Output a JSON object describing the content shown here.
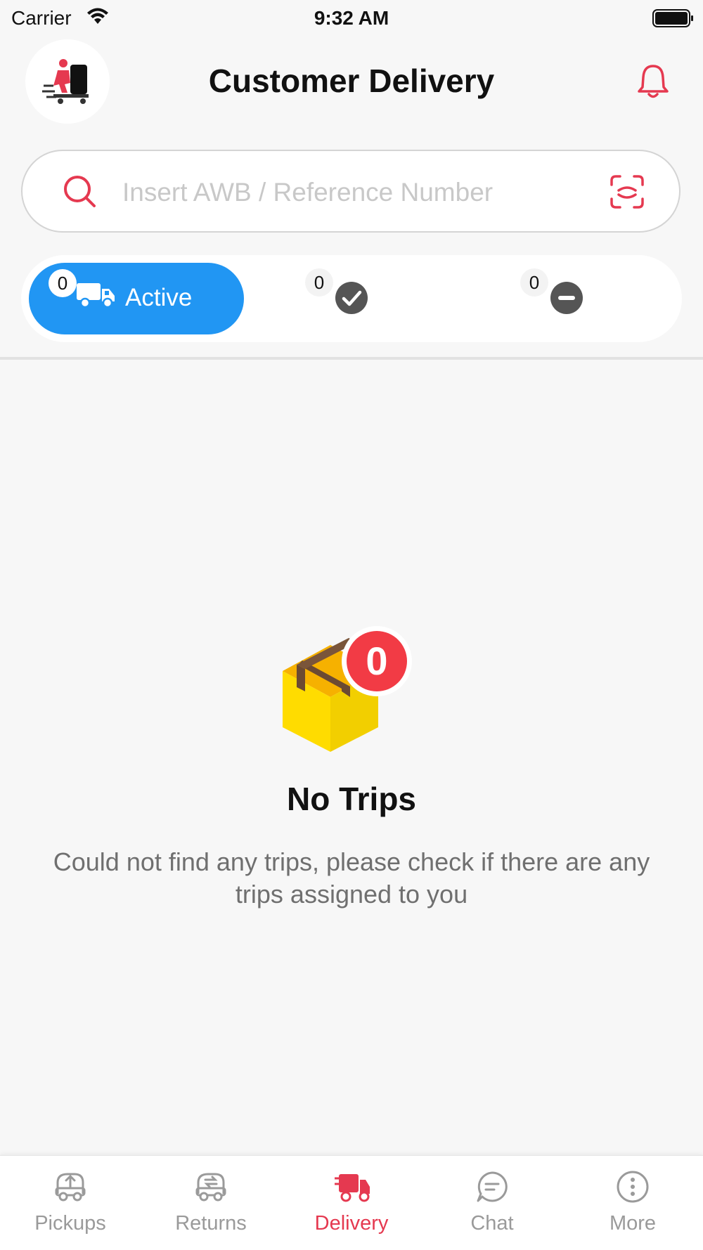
{
  "status_bar": {
    "carrier": "Carrier",
    "time": "9:32 AM",
    "icons": [
      "wifi-icon",
      "battery-icon"
    ]
  },
  "header": {
    "title": "Customer Delivery",
    "logo": "delivery-courier-logo",
    "right_icon": "bell-icon"
  },
  "search": {
    "placeholder": "Insert AWB / Reference Number",
    "value": "",
    "left_icon": "search-icon",
    "right_icon": "scan-icon"
  },
  "filter_tabs": [
    {
      "label": "Active",
      "count": "0",
      "icon": "truck-icon",
      "selected": true
    },
    {
      "label": "",
      "count": "0",
      "icon": "check-circle-icon",
      "selected": false
    },
    {
      "label": "",
      "count": "0",
      "icon": "minus-circle-icon",
      "selected": false
    }
  ],
  "empty_state": {
    "icon": "box-icon",
    "badge_count": "0",
    "title": "No Trips",
    "message": "Could not find any trips, please check if there are any trips assigned to you"
  },
  "tab_bar": {
    "items": [
      {
        "label": "Pickups",
        "icon": "pickup-truck-icon",
        "active": false
      },
      {
        "label": "Returns",
        "icon": "returns-truck-icon",
        "active": false
      },
      {
        "label": "Delivery",
        "icon": "delivery-truck-icon",
        "active": true
      },
      {
        "label": "Chat",
        "icon": "chat-icon",
        "active": false
      },
      {
        "label": "More",
        "icon": "more-icon",
        "active": false
      }
    ]
  },
  "colors": {
    "accent": "#e53950",
    "primary_blue": "#2196f3",
    "background": "#f7f7f7",
    "inactive_gray": "#9a9a9a"
  }
}
